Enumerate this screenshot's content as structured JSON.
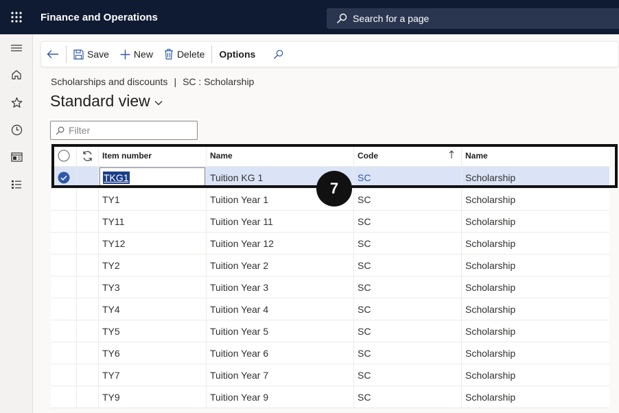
{
  "header": {
    "app_title": "Finance and Operations",
    "search_label": "Search for a page"
  },
  "nav": {
    "items": [
      {
        "icon": "menu-icon"
      },
      {
        "icon": "home-icon"
      },
      {
        "icon": "star-icon"
      },
      {
        "icon": "clock-icon"
      },
      {
        "icon": "workspace-icon"
      },
      {
        "icon": "list-icon"
      }
    ]
  },
  "actionbar": {
    "save_label": "Save",
    "new_label": "New",
    "delete_label": "Delete",
    "options_label": "Options"
  },
  "breadcrumb": {
    "part1": "Scholarships and discounts",
    "separator": "|",
    "part2": "SC : Scholarship"
  },
  "view": {
    "title": "Standard view"
  },
  "filter": {
    "placeholder": "Filter"
  },
  "grid": {
    "columns": [
      "Item number",
      "Name",
      "Code",
      "Name"
    ],
    "rows": [
      {
        "item": "TKG1",
        "name": "Tuition KG 1",
        "code": "SC",
        "cname": "Scholarship",
        "selected": true
      },
      {
        "item": "TY1",
        "name": "Tuition Year 1",
        "code": "SC",
        "cname": "Scholarship"
      },
      {
        "item": "TY11",
        "name": "Tuition Year 11",
        "code": "SC",
        "cname": "Scholarship"
      },
      {
        "item": "TY12",
        "name": "Tuition Year 12",
        "code": "SC",
        "cname": "Scholarship"
      },
      {
        "item": "TY2",
        "name": "Tuition Year 2",
        "code": "SC",
        "cname": "Scholarship"
      },
      {
        "item": "TY3",
        "name": "Tuition Year 3",
        "code": "SC",
        "cname": "Scholarship"
      },
      {
        "item": "TY4",
        "name": "Tuition Year 4",
        "code": "SC",
        "cname": "Scholarship"
      },
      {
        "item": "TY5",
        "name": "Tuition Year 5",
        "code": "SC",
        "cname": "Scholarship"
      },
      {
        "item": "TY6",
        "name": "Tuition Year 6",
        "code": "SC",
        "cname": "Scholarship"
      },
      {
        "item": "TY7",
        "name": "Tuition Year 7",
        "code": "SC",
        "cname": "Scholarship"
      },
      {
        "item": "TY9",
        "name": "Tuition Year 9",
        "code": "SC",
        "cname": "Scholarship"
      }
    ]
  },
  "callout": {
    "step": "7"
  },
  "colors": {
    "topbar": "#0f1b33",
    "accent": "#2f58a8",
    "selected_row": "#dbe4f7"
  }
}
